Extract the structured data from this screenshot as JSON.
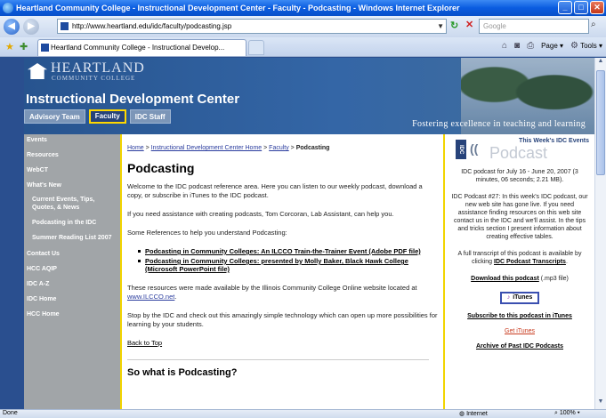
{
  "window": {
    "title": "Heartland Community College - Instructional Development Center - Faculty - Podcasting - Windows Internet Explorer"
  },
  "browser": {
    "url": "http://www.heartland.edu/idc/faculty/podcasting.jsp",
    "search_placeholder": "Google",
    "tab_title": "Heartland Community College - Instructional Develop...",
    "page_label": "Page",
    "tools_label": "Tools"
  },
  "banner": {
    "logo_name": "HEARTLAND",
    "logo_sub": "COMMUNITY COLLEGE",
    "title": "Instructional Development Center",
    "tabs": [
      {
        "label": "Advisory Team"
      },
      {
        "label": "Faculty"
      },
      {
        "label": "IDC Staff"
      }
    ],
    "tagline": "Fostering excellence in teaching and learning"
  },
  "leftnav": {
    "items": [
      {
        "label": "Events"
      },
      {
        "label": "Resources"
      },
      {
        "label": "WebCT"
      },
      {
        "label": "What's New"
      },
      {
        "label": "Current Events, Tips, Quotes, & News"
      },
      {
        "label": "Podcasting in the IDC"
      },
      {
        "label": "Summer Reading List 2007"
      },
      {
        "label": "Contact Us"
      },
      {
        "label": "HCC AQIP"
      },
      {
        "label": "IDC A-Z"
      },
      {
        "label": "IDC Home"
      },
      {
        "label": "HCC Home"
      }
    ]
  },
  "main": {
    "breadcrumb": {
      "home": "Home",
      "sep1": " > ",
      "idc": "Instructional Development Center Home",
      "sep2": " > ",
      "faculty": "Faculty",
      "sep3": " > ",
      "current": "Podcasting"
    },
    "title": "Podcasting",
    "intro": "Welcome to the IDC podcast reference area. Here you can listen to our weekly podcast, download a copy, or subscribe in iTunes to the IDC podcast.",
    "assist": "If you need assistance with creating podcasts, Tom Corcoran, Lab Assistant, can help you.",
    "refs_intro": "Some References to help you understand Podcasting:",
    "refs": [
      {
        "label": "Podcasting in Community Colleges: An ILCCO Train-the-Trainer Event (Adobe PDF file)"
      },
      {
        "label": "Podcasting in Community Colleges: presented by Molly Baker, Black Hawk College (Microsoft PowerPoint file)"
      }
    ],
    "resources_text": "These resources were made available by the Illinois Community College Online website located at ",
    "resources_link": "www.ILCCO.net",
    "resources_end": ".",
    "stop_by": "Stop by the IDC and check out this amazingly simple technology which can open up more possibilities for learning by your students.",
    "back_to_top": "Back to Top",
    "subtitle": "So what is Podcasting?"
  },
  "right": {
    "idc_badge": "IDC",
    "podcast_word": "Podcast",
    "weekly_label": "This Week's IDC Events",
    "episode": "IDC podcast for July 16 - June 20, 2007 (3 minutes, 06 seconds; 2.21 MB).",
    "description": "IDC Podcast #27: In this week's IDC podcast, our new web site has gone live. If you need assistance finding resources on this web site contact us in the IDC and we'll assist. In the tips and tricks section I present information about creating effective tables.",
    "transcript_text": "A full transcript of this podcast is available by clicking ",
    "transcript_link": "IDC Podcast Transcripts",
    "transcript_end": ".",
    "download_link": "Download this podcast",
    "download_note": " (.mp3 file)",
    "itunes_button": "iTunes",
    "subscribe_link": "Subscribe to this podcast in iTunes",
    "get_itunes": "Get iTunes",
    "archive_link": "Archive of Past IDC Podcasts"
  },
  "status": {
    "left": "Done",
    "zone": "Internet",
    "zoom": "100%"
  },
  "colors": {
    "banner_blue": "#27548f",
    "accent_yellow": "#f2d400",
    "leftnav_gray": "#a1a5a8"
  }
}
